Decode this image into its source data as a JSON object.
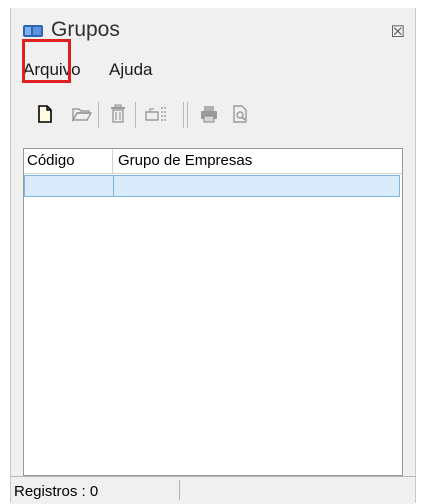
{
  "window": {
    "title": "Grupos",
    "close_glyph": "☒"
  },
  "menu": [
    {
      "label": "Arquivo"
    },
    {
      "label": "Ajuda"
    }
  ],
  "toolbar": {
    "buttons": [
      {
        "icon": "new-document-icon",
        "highlighted": true
      },
      {
        "icon": "open-folder-icon"
      },
      {
        "icon": "trash-icon"
      },
      {
        "icon": "edit-form-icon"
      },
      {
        "icon": "printer-icon"
      },
      {
        "icon": "print-preview-icon"
      }
    ],
    "highlight_color": "#e02020"
  },
  "grid": {
    "columns": [
      "Código",
      "Grupo de Empresas"
    ],
    "rows": [
      {
        "codigo": "",
        "grupo": ""
      }
    ]
  },
  "status": {
    "text": "Registros : 0"
  }
}
